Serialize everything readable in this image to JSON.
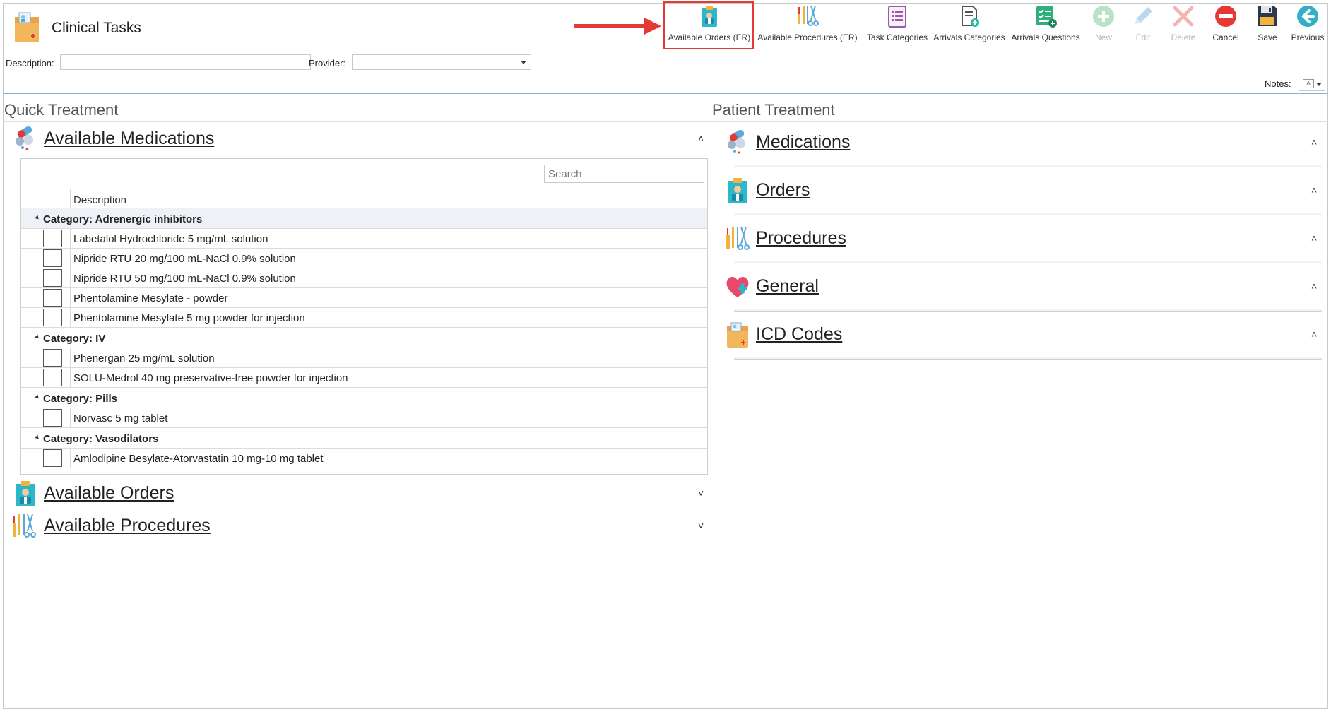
{
  "app": {
    "title": "Clinical Tasks"
  },
  "toolbar": {
    "buttons": [
      {
        "label": "Available Orders (ER)",
        "icon": "clipboard-doctor-icon",
        "highlighted": true
      },
      {
        "label": "Available Procedures (ER)",
        "icon": "surgical-tools-icon"
      },
      {
        "label": "Task Categories",
        "icon": "list-document-icon"
      },
      {
        "label": "Arrivals Categories",
        "icon": "document-add-icon"
      },
      {
        "label": "Arrivals Questions",
        "icon": "checklist-add-icon"
      },
      {
        "label": "New",
        "icon": "plus-icon",
        "disabled": true
      },
      {
        "label": "Edit",
        "icon": "pencil-icon",
        "disabled": true
      },
      {
        "label": "Delete",
        "icon": "x-icon",
        "disabled": true
      },
      {
        "label": "Cancel",
        "icon": "no-entry-icon"
      },
      {
        "label": "Save",
        "icon": "floppy-disk-icon"
      },
      {
        "label": "Previous",
        "icon": "arrow-left-icon"
      }
    ]
  },
  "filters": {
    "description_label": "Description:",
    "description_value": "",
    "provider_label": "Provider:",
    "provider_value": ""
  },
  "notes": {
    "label": "Notes:"
  },
  "quick_treatment": {
    "title": "Quick Treatment",
    "available_medications": {
      "title": "Available Medications",
      "search_placeholder": "Search",
      "column_header": "Description",
      "categories": [
        {
          "name": "Category: Adrenergic inhibitors",
          "items": [
            "Labetalol Hydrochloride 5 mg/mL solution",
            "Nipride RTU 20 mg/100 mL-NaCl 0.9% solution",
            "Nipride RTU 50 mg/100 mL-NaCl 0.9% solution",
            "Phentolamine Mesylate - powder",
            "Phentolamine Mesylate 5 mg powder for injection"
          ]
        },
        {
          "name": "Category: IV",
          "items": [
            "Phenergan 25 mg/mL solution",
            "SOLU-Medrol 40 mg preservative-free powder for injection"
          ]
        },
        {
          "name": "Category: Pills",
          "items": [
            "Norvasc 5 mg tablet"
          ]
        },
        {
          "name": "Category: Vasodilators",
          "items": [
            "Amlodipine Besylate-Atorvastatin 10 mg-10 mg tablet"
          ]
        }
      ]
    },
    "available_orders": {
      "title": "Available Orders"
    },
    "available_procedures": {
      "title": "Available Procedures"
    }
  },
  "patient_treatment": {
    "title": "Patient Treatment",
    "groups": [
      {
        "title": "Medications",
        "icon": "pills-icon"
      },
      {
        "title": "Orders",
        "icon": "clipboard-doctor-icon"
      },
      {
        "title": "Procedures",
        "icon": "surgical-tools-icon"
      },
      {
        "title": "General",
        "icon": "heart-plus-icon"
      },
      {
        "title": "ICD Codes",
        "icon": "medical-folder-icon"
      }
    ]
  },
  "colors": {
    "accent": "#8fb1d8",
    "highlight": "#e53935",
    "arrow": "#e53935"
  }
}
